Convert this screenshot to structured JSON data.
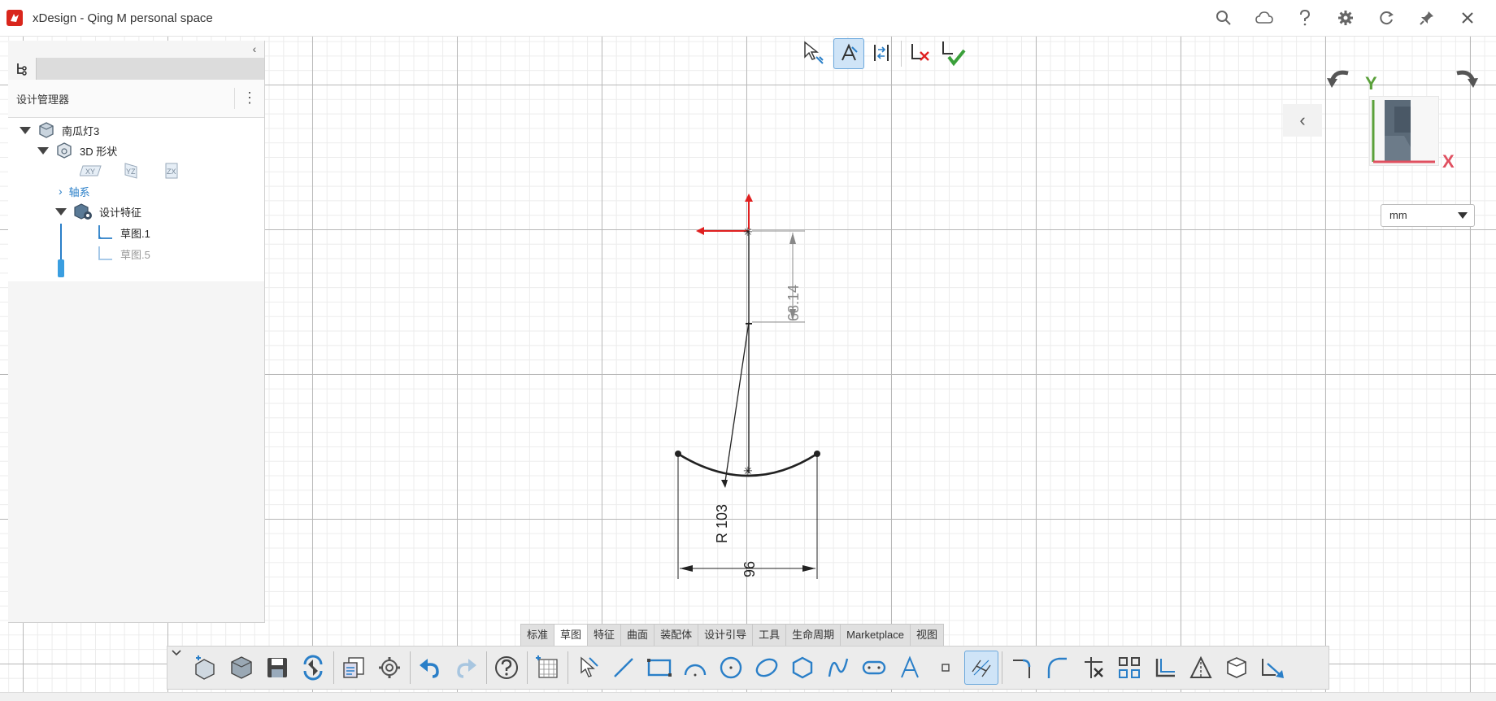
{
  "titlebar": {
    "title": "xDesign - Qing M personal space",
    "icons": [
      "search-icon",
      "cloud-icon",
      "help-icon",
      "settings-gear-icon",
      "refresh-icon",
      "pin-icon",
      "close-icon"
    ],
    "brand_color": "#d9261c"
  },
  "design_manager": {
    "title": "设计管理器",
    "tree": {
      "root_label": "南瓜灯3",
      "shape_label": "3D 形状",
      "planes": [
        "XY",
        "YZ",
        "ZX"
      ],
      "axes_label": "轴系",
      "features_label": "设计特征",
      "sketches": [
        "草图.1",
        "草图.5"
      ]
    }
  },
  "sketch": {
    "dim_vertical": "68.14",
    "dim_radius": "R 103",
    "dim_width": "96"
  },
  "viewport": {
    "axis_y_label": "Y",
    "axis_x_label": "X",
    "units": "mm",
    "rotate_icons": [
      "rotate-left-icon",
      "rotate-right-icon"
    ]
  },
  "ribbon": {
    "tabs": [
      "标准",
      "草图",
      "特征",
      "曲面",
      "装配体",
      "设计引导",
      "工具",
      "生命周期",
      "Marketplace",
      "视图"
    ],
    "active_tab": "草图",
    "tools": [
      "new-sketch-icon",
      "model-icon",
      "save-icon",
      "revisions-icon",
      "clipboard-icon",
      "settings-icon",
      "undo-icon",
      "redo-icon",
      "help-icon",
      "sketch-grid-icon",
      "select-icon",
      "line-icon",
      "rectangle-icon",
      "arc-icon",
      "circle-icon",
      "ellipse-icon",
      "polygon-icon",
      "spline-icon",
      "slot-icon",
      "text-icon",
      "point-icon",
      "smart-dimension-icon",
      "fillet-icon",
      "chamfer-icon",
      "trim-icon",
      "mirror-icon",
      "offset-icon",
      "construction-icon",
      "cube-icon",
      "convert-icon"
    ]
  },
  "colors": {
    "accent": "#2a7fc8",
    "selection_red": "#e02020",
    "confirm_green": "#3aa03a"
  }
}
